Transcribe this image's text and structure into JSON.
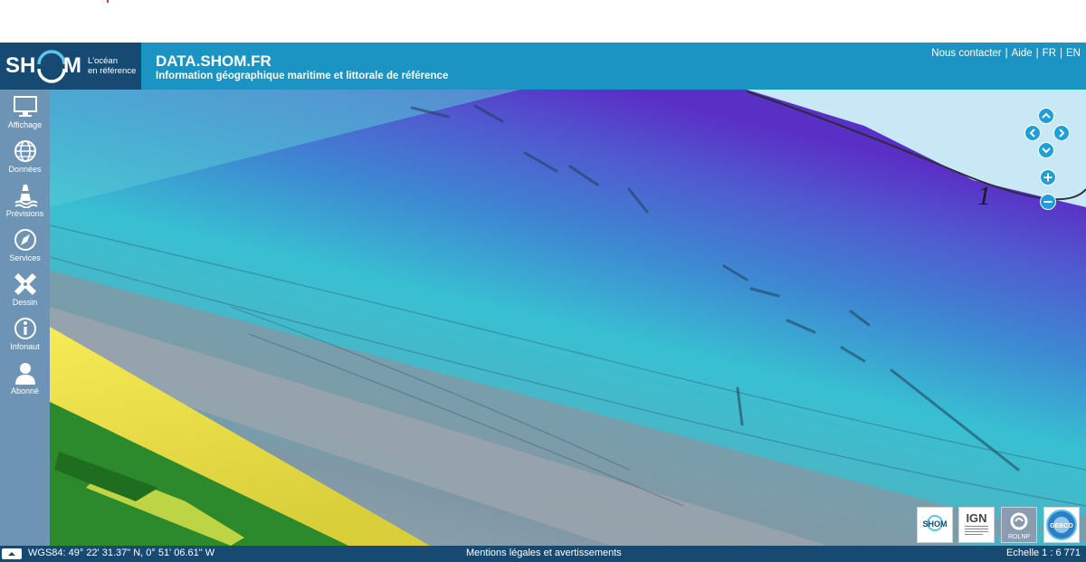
{
  "header": {
    "brand": {
      "left": "SH",
      "right": "M",
      "tagline_1": "L'océan",
      "tagline_2": "en référence"
    },
    "title": "DATA.SHOM.FR",
    "subtitle": "Information géographique maritime et littorale de référence",
    "links": {
      "contact": "Nous contacter",
      "sep1": " | ",
      "help": "Aide",
      "sep2": " | ",
      "fr": "FR",
      "sep3": " | ",
      "en": "EN"
    }
  },
  "sidebar": {
    "items": [
      {
        "label": "Affichage",
        "icon": "monitor-icon"
      },
      {
        "label": "Données",
        "icon": "globe-icon"
      },
      {
        "label": "Prévisions",
        "icon": "buoy-icon"
      },
      {
        "label": "Services",
        "icon": "compass-icon"
      },
      {
        "label": "Dessin",
        "icon": "pencil-ruler-icon"
      },
      {
        "label": "Infonaut",
        "icon": "info-icon"
      },
      {
        "label": "Abonné",
        "icon": "user-icon"
      }
    ]
  },
  "map": {
    "contour_label": "1",
    "controls": [
      "pan-up",
      "pan-left",
      "pan-right",
      "pan-down",
      "zoom-in",
      "zoom-out"
    ],
    "colors": {
      "land_green": "#2d8a2c",
      "beach_yellow": "#f2e24a",
      "shallow_gray": "#8a9aa6",
      "mid_cyan": "#3fc6d2",
      "deep_blue": "#5566cc",
      "deepest_violet": "#5a2fc6",
      "control": "#1f9fd8"
    }
  },
  "logos": [
    {
      "name": "shom-logo",
      "label": "SHOM"
    },
    {
      "name": "ign-logo",
      "label": "IGN",
      "caption": "INSTITUT NATIONAL DE L'INFORMATION GÉOGRAPHIQUE ET FORESTIÈRE"
    },
    {
      "name": "rolnp-logo",
      "label": "ROLNP"
    },
    {
      "name": "gebco-logo",
      "label": "GEBCO"
    }
  ],
  "footer": {
    "coords": "WGS84: 49° 22' 31.37\" N, 0° 51' 06.61\" W",
    "legal": "Mentions légales et avertissements",
    "scale": "Echelle 1 : 6 771"
  }
}
